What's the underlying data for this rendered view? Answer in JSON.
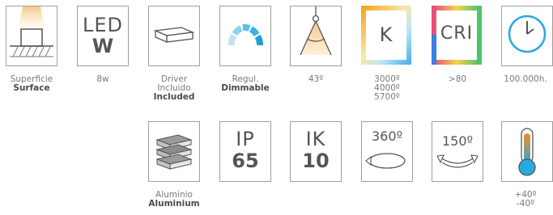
{
  "row1": {
    "surface": {
      "line1": "Superficie",
      "line2": "Surface",
      "icon": "surface-mount-icon"
    },
    "power": {
      "top": "LED",
      "bottom": "W",
      "caption": "8w"
    },
    "driver": {
      "line1": "Driver",
      "line2": "Incluido",
      "line3": "Included",
      "icon": "driver-icon"
    },
    "dimmable": {
      "line1": "Regul.",
      "line2": "Dimmable",
      "icon": "dimmable-gauge-icon"
    },
    "beam": {
      "caption": "43º",
      "icon": "beam-angle-icon"
    },
    "cct": {
      "letter": "K",
      "line1": "3000º",
      "line2": "4000º",
      "line3": "5700º"
    },
    "cri": {
      "letter": "CRI",
      "caption": ">80"
    },
    "lifetime": {
      "caption": "100.000h.",
      "icon": "clock-icon"
    }
  },
  "row2": {
    "aluminium": {
      "line1": "Aluminio",
      "line2": "Aluminium",
      "icon": "aluminium-bars-icon"
    },
    "ip": {
      "top": "IP",
      "bottom": "65"
    },
    "ik": {
      "top": "IK",
      "bottom": "10"
    },
    "rot360": {
      "label": "360º",
      "icon": "rotate-360-icon"
    },
    "tilt150": {
      "label": "150º",
      "icon": "tilt-150-icon"
    },
    "temperature": {
      "line1": "+40º",
      "line2": "-40º",
      "icon": "thermometer-icon"
    }
  },
  "colors": {
    "border": "#9e9e9e",
    "accent_blue": "#29a9e1",
    "warm": "#f6c98d"
  }
}
